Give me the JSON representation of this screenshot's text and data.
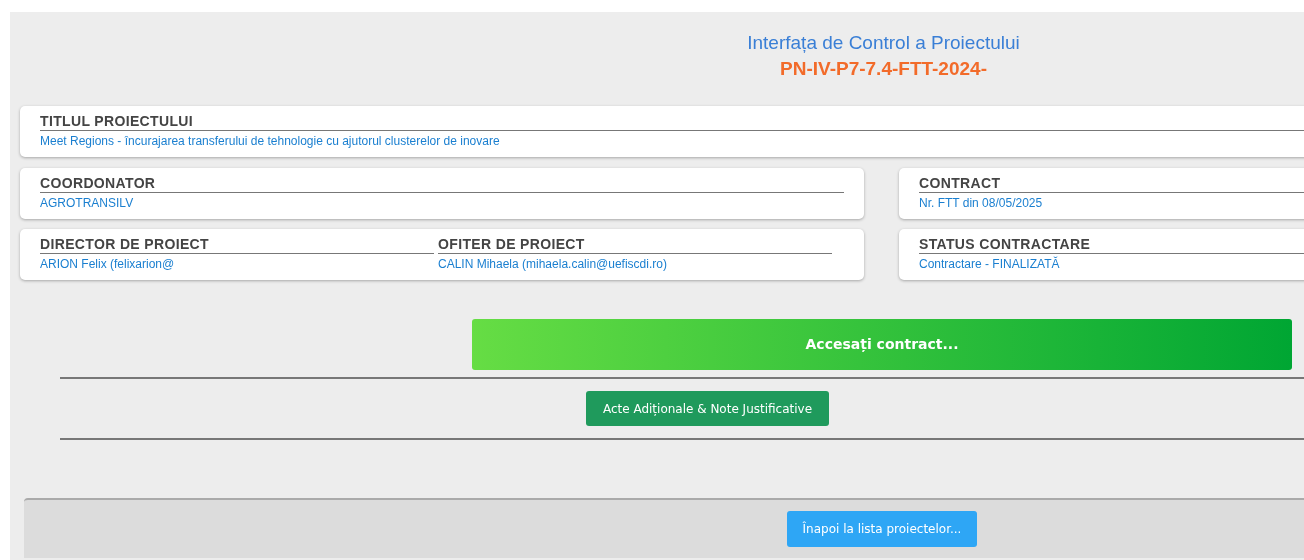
{
  "header": {
    "title": "Interfața de Control a Proiectului",
    "code": "PN-IV-P7-7.4-FTT-2024-"
  },
  "title_card": {
    "label": "TITLUL PROIECTULUI",
    "value": "Meet Regions - încurajarea transferului de tehnologie cu ajutorul clusterelor de inovare"
  },
  "coordinator_card": {
    "label": "COORDONATOR",
    "value": "AGROTRANSILV"
  },
  "contract_card": {
    "label": "CONTRACT",
    "value": "Nr. FTT din 08/05/2025"
  },
  "people_card": [
    {
      "label": "DIRECTOR DE PROIECT",
      "value": "ARION Felix (felixarion@"
    },
    {
      "label": "OFITER DE PROIECT",
      "value": "CALIN Mihaela (mihaela.calin@uefiscdi.ro)"
    }
  ],
  "status_card": {
    "label": "STATUS CONTRACTARE",
    "value": "Contractare - FINALIZATĂ"
  },
  "buttons": {
    "access_contract": "Accesați contract...",
    "addenda": "Acte Adiționale & Note Justificative",
    "back": "Înapoi la lista proiectelor..."
  }
}
